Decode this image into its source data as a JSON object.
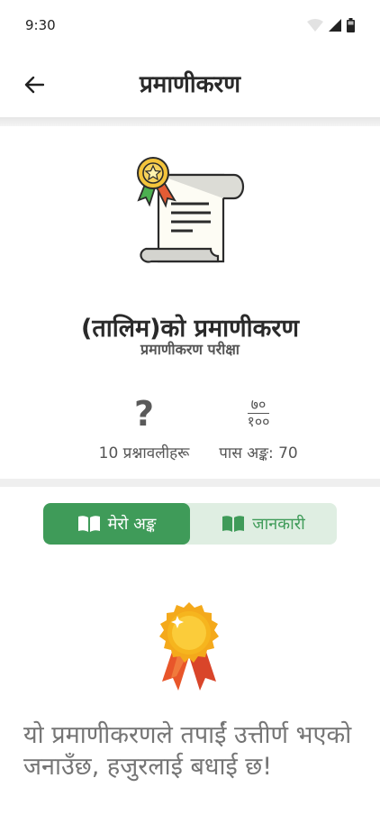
{
  "status": {
    "time": "9:30",
    "icons": [
      "wifi-icon",
      "signal-icon",
      "battery-icon"
    ]
  },
  "header": {
    "title": "प्रमाणीकरण",
    "back_icon": "arrow-left-icon"
  },
  "certificate": {
    "title": "(तालिम)को प्रमाणीकरण",
    "subtitle": "प्रमाणीकरण परीक्षा"
  },
  "stats": {
    "questions": {
      "icon": "?",
      "label": "10 प्रश्नावलीहरू"
    },
    "pass": {
      "numerator": "७०",
      "denominator": "१००",
      "label": "पास अङ्क: 70"
    }
  },
  "tabs": [
    {
      "label": "मेरो अङ्क",
      "icon": "book-icon",
      "active": true
    },
    {
      "label": "जानकारी",
      "icon": "book-icon",
      "active": false
    }
  ],
  "result": {
    "message": "यो प्रमाणीकरणले तपाईं उत्तीर्ण भएको जनाउँछ, हजुरलाई बधाई छ!"
  },
  "colors": {
    "accent_green": "#3f9b59",
    "tab_bg_light": "#dfeee2",
    "medal_gold": "#f6b51e",
    "ribbon_orange": "#e8562a"
  }
}
